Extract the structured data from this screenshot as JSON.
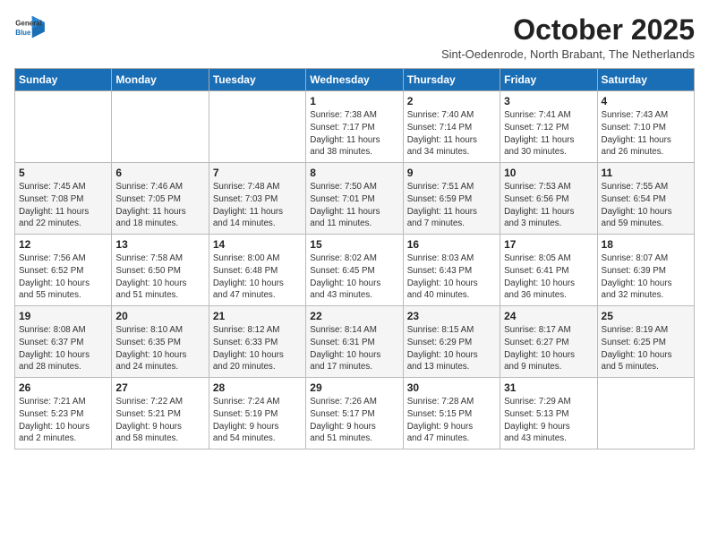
{
  "logo": {
    "line1": "General",
    "line2": "Blue"
  },
  "header": {
    "month": "October 2025",
    "location": "Sint-Oedenrode, North Brabant, The Netherlands"
  },
  "weekdays": [
    "Sunday",
    "Monday",
    "Tuesday",
    "Wednesday",
    "Thursday",
    "Friday",
    "Saturday"
  ],
  "weeks": [
    [
      {
        "day": "",
        "info": ""
      },
      {
        "day": "",
        "info": ""
      },
      {
        "day": "",
        "info": ""
      },
      {
        "day": "1",
        "info": "Sunrise: 7:38 AM\nSunset: 7:17 PM\nDaylight: 11 hours\nand 38 minutes."
      },
      {
        "day": "2",
        "info": "Sunrise: 7:40 AM\nSunset: 7:14 PM\nDaylight: 11 hours\nand 34 minutes."
      },
      {
        "day": "3",
        "info": "Sunrise: 7:41 AM\nSunset: 7:12 PM\nDaylight: 11 hours\nand 30 minutes."
      },
      {
        "day": "4",
        "info": "Sunrise: 7:43 AM\nSunset: 7:10 PM\nDaylight: 11 hours\nand 26 minutes."
      }
    ],
    [
      {
        "day": "5",
        "info": "Sunrise: 7:45 AM\nSunset: 7:08 PM\nDaylight: 11 hours\nand 22 minutes."
      },
      {
        "day": "6",
        "info": "Sunrise: 7:46 AM\nSunset: 7:05 PM\nDaylight: 11 hours\nand 18 minutes."
      },
      {
        "day": "7",
        "info": "Sunrise: 7:48 AM\nSunset: 7:03 PM\nDaylight: 11 hours\nand 14 minutes."
      },
      {
        "day": "8",
        "info": "Sunrise: 7:50 AM\nSunset: 7:01 PM\nDaylight: 11 hours\nand 11 minutes."
      },
      {
        "day": "9",
        "info": "Sunrise: 7:51 AM\nSunset: 6:59 PM\nDaylight: 11 hours\nand 7 minutes."
      },
      {
        "day": "10",
        "info": "Sunrise: 7:53 AM\nSunset: 6:56 PM\nDaylight: 11 hours\nand 3 minutes."
      },
      {
        "day": "11",
        "info": "Sunrise: 7:55 AM\nSunset: 6:54 PM\nDaylight: 10 hours\nand 59 minutes."
      }
    ],
    [
      {
        "day": "12",
        "info": "Sunrise: 7:56 AM\nSunset: 6:52 PM\nDaylight: 10 hours\nand 55 minutes."
      },
      {
        "day": "13",
        "info": "Sunrise: 7:58 AM\nSunset: 6:50 PM\nDaylight: 10 hours\nand 51 minutes."
      },
      {
        "day": "14",
        "info": "Sunrise: 8:00 AM\nSunset: 6:48 PM\nDaylight: 10 hours\nand 47 minutes."
      },
      {
        "day": "15",
        "info": "Sunrise: 8:02 AM\nSunset: 6:45 PM\nDaylight: 10 hours\nand 43 minutes."
      },
      {
        "day": "16",
        "info": "Sunrise: 8:03 AM\nSunset: 6:43 PM\nDaylight: 10 hours\nand 40 minutes."
      },
      {
        "day": "17",
        "info": "Sunrise: 8:05 AM\nSunset: 6:41 PM\nDaylight: 10 hours\nand 36 minutes."
      },
      {
        "day": "18",
        "info": "Sunrise: 8:07 AM\nSunset: 6:39 PM\nDaylight: 10 hours\nand 32 minutes."
      }
    ],
    [
      {
        "day": "19",
        "info": "Sunrise: 8:08 AM\nSunset: 6:37 PM\nDaylight: 10 hours\nand 28 minutes."
      },
      {
        "day": "20",
        "info": "Sunrise: 8:10 AM\nSunset: 6:35 PM\nDaylight: 10 hours\nand 24 minutes."
      },
      {
        "day": "21",
        "info": "Sunrise: 8:12 AM\nSunset: 6:33 PM\nDaylight: 10 hours\nand 20 minutes."
      },
      {
        "day": "22",
        "info": "Sunrise: 8:14 AM\nSunset: 6:31 PM\nDaylight: 10 hours\nand 17 minutes."
      },
      {
        "day": "23",
        "info": "Sunrise: 8:15 AM\nSunset: 6:29 PM\nDaylight: 10 hours\nand 13 minutes."
      },
      {
        "day": "24",
        "info": "Sunrise: 8:17 AM\nSunset: 6:27 PM\nDaylight: 10 hours\nand 9 minutes."
      },
      {
        "day": "25",
        "info": "Sunrise: 8:19 AM\nSunset: 6:25 PM\nDaylight: 10 hours\nand 5 minutes."
      }
    ],
    [
      {
        "day": "26",
        "info": "Sunrise: 7:21 AM\nSunset: 5:23 PM\nDaylight: 10 hours\nand 2 minutes."
      },
      {
        "day": "27",
        "info": "Sunrise: 7:22 AM\nSunset: 5:21 PM\nDaylight: 9 hours\nand 58 minutes."
      },
      {
        "day": "28",
        "info": "Sunrise: 7:24 AM\nSunset: 5:19 PM\nDaylight: 9 hours\nand 54 minutes."
      },
      {
        "day": "29",
        "info": "Sunrise: 7:26 AM\nSunset: 5:17 PM\nDaylight: 9 hours\nand 51 minutes."
      },
      {
        "day": "30",
        "info": "Sunrise: 7:28 AM\nSunset: 5:15 PM\nDaylight: 9 hours\nand 47 minutes."
      },
      {
        "day": "31",
        "info": "Sunrise: 7:29 AM\nSunset: 5:13 PM\nDaylight: 9 hours\nand 43 minutes."
      },
      {
        "day": "",
        "info": ""
      }
    ]
  ]
}
